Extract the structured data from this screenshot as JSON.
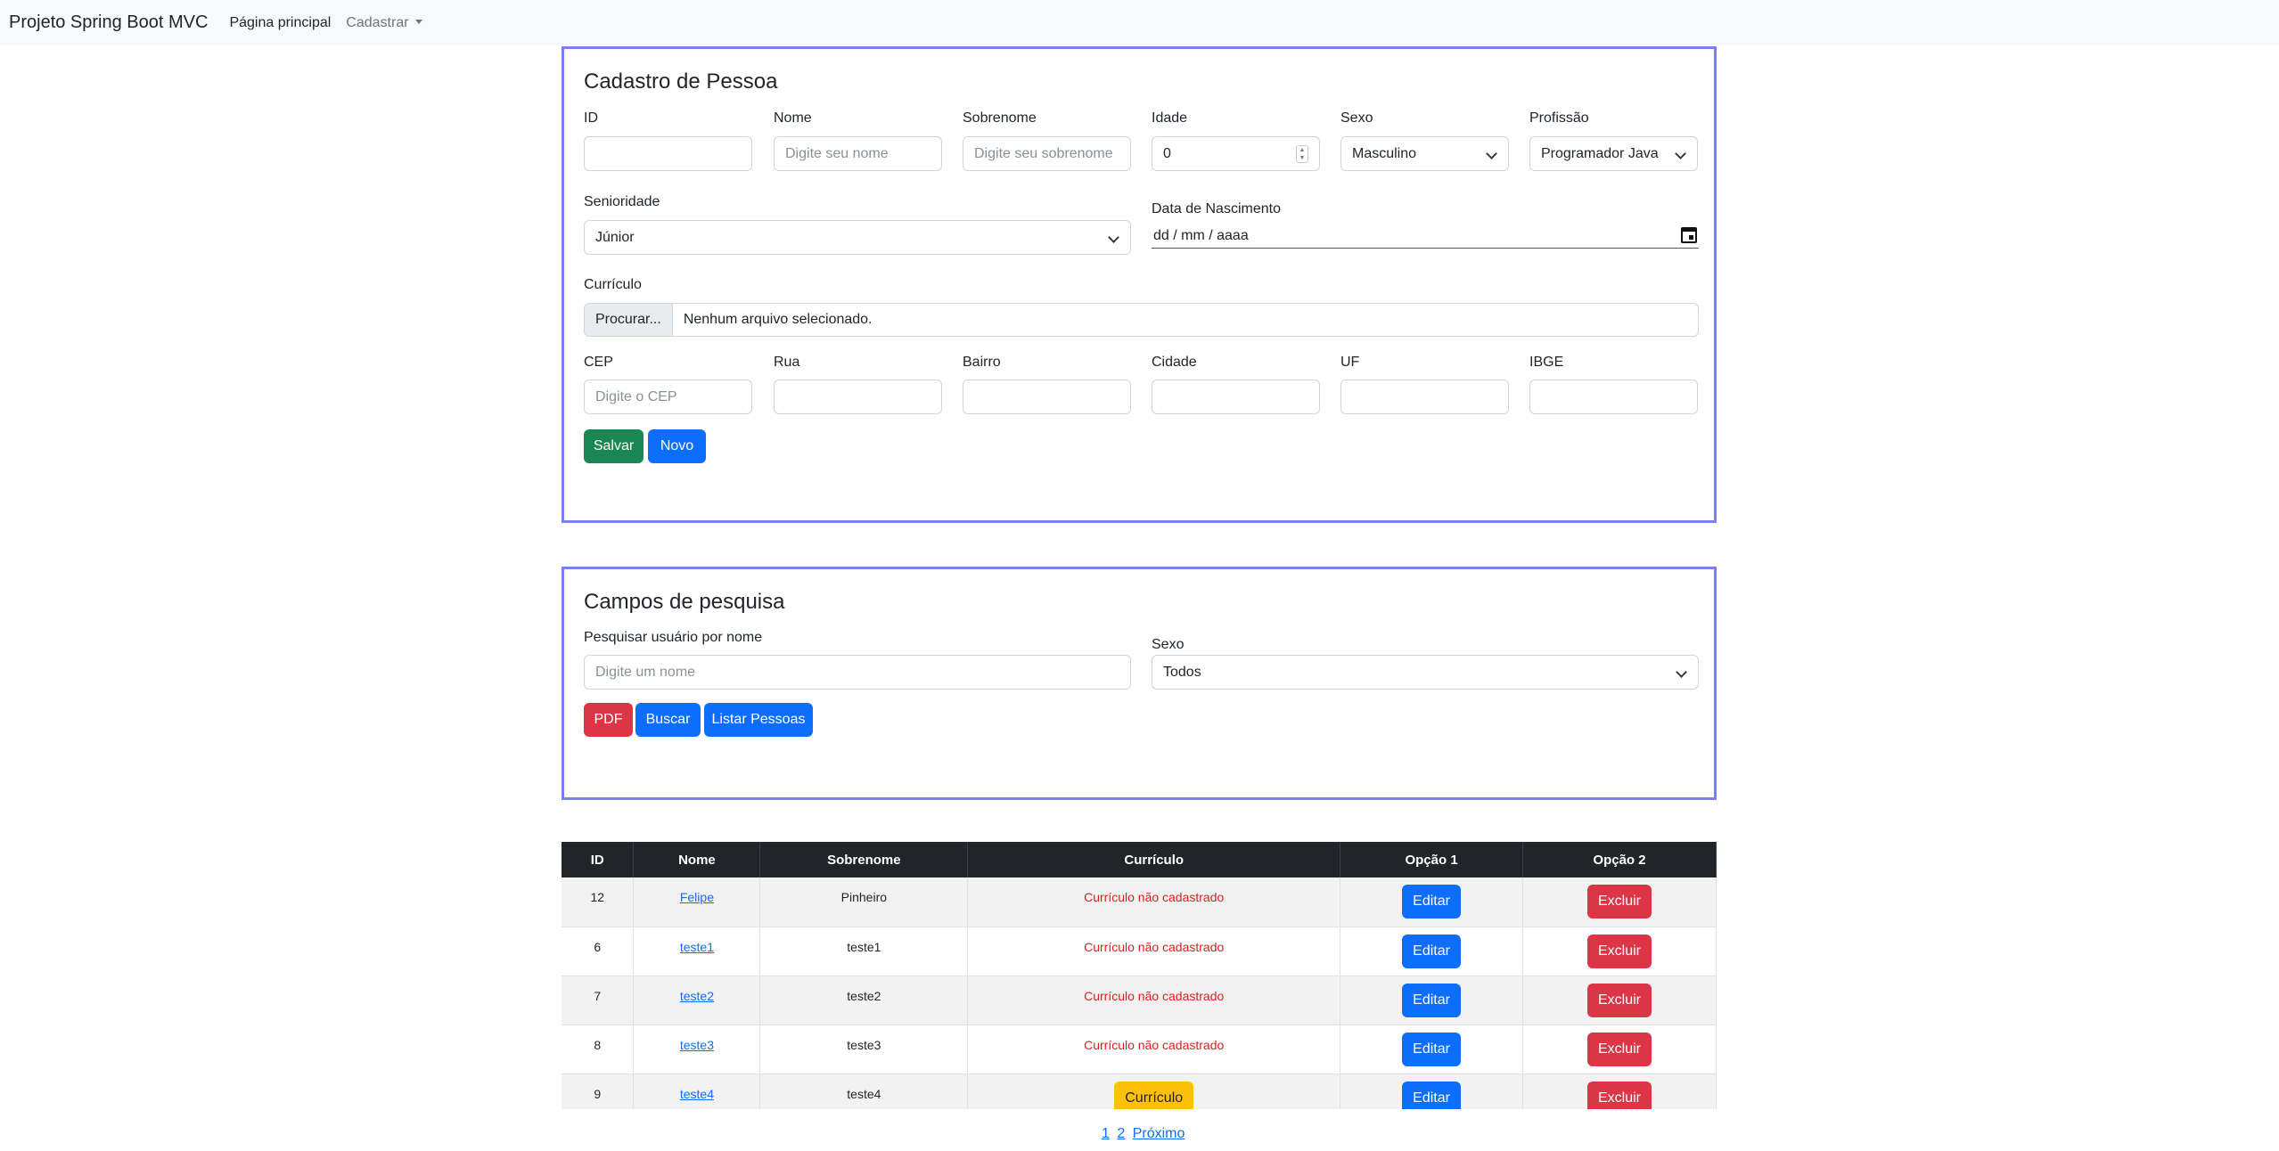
{
  "navbar": {
    "brand": "Projeto Spring Boot MVC",
    "home": "Página principal",
    "register": "Cadastrar"
  },
  "cadastro": {
    "title": "Cadastro de Pessoa",
    "id_label": "ID",
    "nome_label": "Nome",
    "nome_placeholder": "Digite seu nome",
    "sobrenome_label": "Sobrenome",
    "sobrenome_placeholder": "Digite seu sobrenome",
    "idade_label": "Idade",
    "idade_value": "0",
    "sexo_label": "Sexo",
    "sexo_value": "Masculino",
    "profissao_label": "Profissão",
    "profissao_value": "Programador Java",
    "senioridade_label": "Senioridade",
    "senioridade_value": "Júnior",
    "nascimento_label": "Data de Nascimento",
    "nascimento_value": "dd / mm / aaaa",
    "curriculo_label": "Currículo",
    "file_button": "Procurar...",
    "file_text": "Nenhum arquivo selecionado.",
    "cep_label": "CEP",
    "cep_placeholder": "Digite o CEP",
    "rua_label": "Rua",
    "bairro_label": "Bairro",
    "cidade_label": "Cidade",
    "uf_label": "UF",
    "ibge_label": "IBGE",
    "salvar": "Salvar",
    "novo": "Novo"
  },
  "pesquisa": {
    "title": "Campos de pesquisa",
    "nome_label": "Pesquisar usuário por nome",
    "nome_placeholder": "Digite um nome",
    "sexo_label": "Sexo",
    "sexo_value": "Todos",
    "pdf": "PDF",
    "buscar": "Buscar",
    "listar": "Listar Pessoas"
  },
  "table": {
    "headers": [
      "ID",
      "Nome",
      "Sobrenome",
      "Currículo",
      "Opção 1",
      "Opção 2"
    ],
    "rows": [
      {
        "id": "12",
        "nome": "Felipe",
        "sobrenome": "Pinheiro",
        "curriculo": "Currículo não cadastrado",
        "has_curriculo": false
      },
      {
        "id": "6",
        "nome": "teste1",
        "sobrenome": "teste1",
        "curriculo": "Currículo não cadastrado",
        "has_curriculo": false
      },
      {
        "id": "7",
        "nome": "teste2",
        "sobrenome": "teste2",
        "curriculo": "Currículo não cadastrado",
        "has_curriculo": false
      },
      {
        "id": "8",
        "nome": "teste3",
        "sobrenome": "teste3",
        "curriculo": "Currículo não cadastrado",
        "has_curriculo": false
      },
      {
        "id": "9",
        "nome": "teste4",
        "sobrenome": "teste4",
        "curriculo": "Currículo",
        "has_curriculo": true
      }
    ],
    "edit_label": "Editar",
    "delete_label": "Excluir"
  },
  "pagination": {
    "pages": [
      "1",
      "2"
    ],
    "next": "Próximo"
  },
  "colors": {
    "panel_border": "#7b7ff0",
    "primary": "#0d6efd",
    "success": "#198754",
    "danger": "#dc3545",
    "warning": "#ffc107"
  }
}
